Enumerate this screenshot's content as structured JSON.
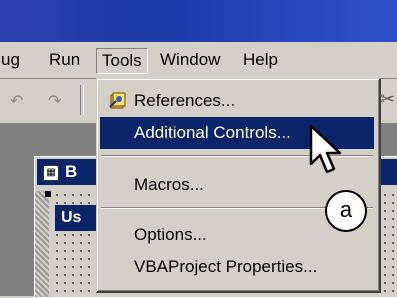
{
  "menubar": {
    "debug": "ug",
    "run": "Run",
    "tools": "Tools",
    "window": "Window",
    "help": "Help"
  },
  "toolbar": {
    "undo_icon": "undo-icon",
    "redo_icon": "redo-icon"
  },
  "child_window": {
    "title": "B",
    "form_title": "Us"
  },
  "tools_menu": {
    "items": [
      {
        "label": "References...",
        "icon": "references-icon"
      },
      {
        "label": "Additional Controls...",
        "highlighted": true
      },
      {
        "label": "Macros..."
      },
      {
        "label": "Options..."
      },
      {
        "label": "VBAProject Properties..."
      }
    ]
  },
  "callout": {
    "label": "a"
  },
  "colors": {
    "highlight": "#0a246a",
    "menu_bg": "#d4d0c8",
    "title_bar": "#1c3aa8"
  }
}
